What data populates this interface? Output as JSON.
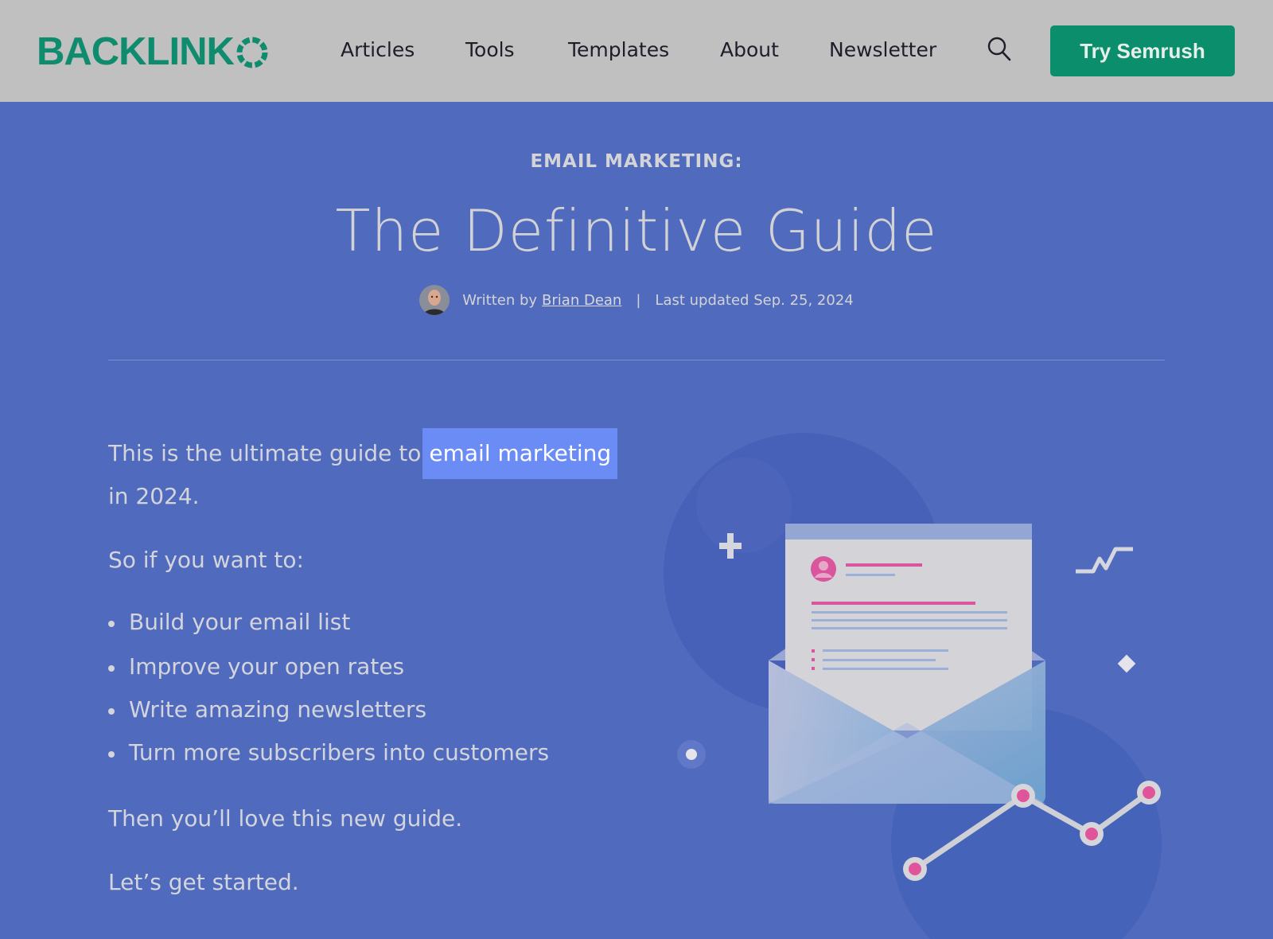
{
  "brand": {
    "logo_text": "BACKLINK",
    "accent": "#0f8c6e"
  },
  "nav": {
    "items": [
      {
        "label": "Articles"
      },
      {
        "label": "Tools"
      },
      {
        "label": "Templates"
      },
      {
        "label": "About"
      },
      {
        "label": "Newsletter"
      }
    ],
    "search_icon": "search-icon",
    "cta_label": "Try Semrush",
    "cta_color": "#0a8e6c"
  },
  "hero": {
    "kicker": "EMAIL MARKETING:",
    "title": "The Definitive Guide",
    "written_by": "Written by",
    "author": "Brian Dean",
    "separator": "|",
    "updated": "Last updated Sep. 25, 2024"
  },
  "content": {
    "intro_before": "This is the ultimate guide to",
    "intro_highlight": "email marketing",
    "intro_after": "in 2024.",
    "lead_in": "So if you want to:",
    "bullets": [
      "Build your email list",
      "Improve your open rates",
      "Write amazing newsletters",
      "Turn more subscribers into customers"
    ],
    "closing_1": "Then you’ll love this new guide.",
    "closing_2": "Let’s get started."
  },
  "colors": {
    "page_bg": "#506bbd",
    "header_bg": "#c0c0c0",
    "highlight_bg": "#6b8cf5",
    "chart_dot": "#e0559a"
  }
}
